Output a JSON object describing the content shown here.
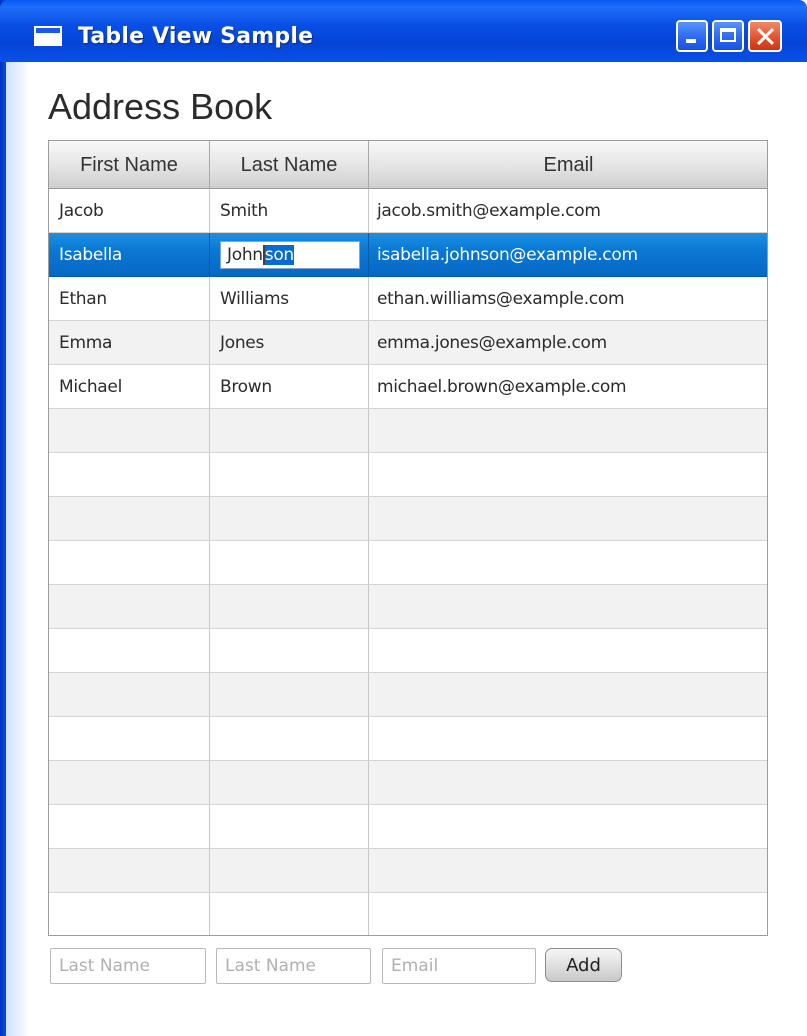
{
  "window": {
    "title": "Table View Sample",
    "title_bar_color": "#0a50e8",
    "controls": {
      "minimize_icon": "minimize-icon",
      "maximize_icon": "maximize-icon",
      "close_icon": "close-icon"
    }
  },
  "page": {
    "heading": "Address Book"
  },
  "table": {
    "columns": [
      "First Name",
      "Last Name",
      "Email"
    ],
    "rows": [
      {
        "first": "Jacob",
        "last": "Smith",
        "email": "jacob.smith@example.com"
      },
      {
        "first": "Isabella",
        "last": "Johnson",
        "email": "isabella.johnson@example.com",
        "selected": true,
        "editing_column": "Last Name",
        "edit_text_before_caret": "John",
        "edit_text_selected": "son"
      },
      {
        "first": "Ethan",
        "last": "Williams",
        "email": "ethan.williams@example.com"
      },
      {
        "first": "Emma",
        "last": "Jones",
        "email": "emma.jones@example.com"
      },
      {
        "first": "Michael",
        "last": "Brown",
        "email": "michael.brown@example.com"
      }
    ],
    "empty_rows": 12,
    "selection_color": "#0a78d4"
  },
  "form": {
    "first_placeholder": "Last Name",
    "last_placeholder": "Last Name",
    "email_placeholder": "Email",
    "add_label": "Add"
  }
}
